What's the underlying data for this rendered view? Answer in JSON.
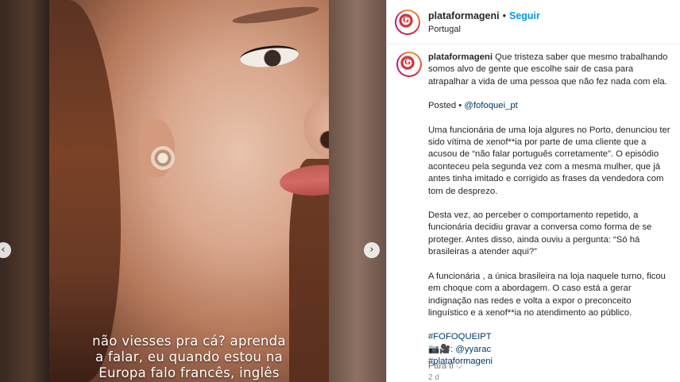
{
  "post": {
    "author": "plataformageni",
    "follow_label": "Seguir",
    "location": "Portugal",
    "avatar_letter": "G"
  },
  "media": {
    "caption_lines": [
      "não viesses pra cá? aprenda",
      "a falar, eu quando estou na",
      "Europa falo francês, inglês"
    ],
    "prev_icon": "chevron-left-icon",
    "next_icon": "chevron-right-icon"
  },
  "caption": {
    "intro": "Que tristeza saber que mesmo trabalhando somos alvo de gente que escolhe sair de casa para atrapalhar a vida de uma pessoa que não fez nada com ela.",
    "posted_label": "Posted •",
    "posted_handle": "@fofoquei_pt",
    "paragraph1": "Uma funcionária de uma loja algures no Porto, denunciou ter sido vítima de xenof**ia por parte de uma cliente que a acusou de “não falar português corretamente”. O episódio aconteceu pela segunda vez com a mesma mulher, que já antes tinha imitado e corrigido as frases da vendedora com tom de desprezo.",
    "paragraph2": "Desta vez, ao perceber o comportamento repetido, a funcionária decidiu gravar a conversa como forma de se proteger. Antes disso, ainda ouviu a pergunta: “Só há brasileiras a atender aqui?”",
    "paragraph3": "A funcionária , a única brasileira na loja naquele turno, ficou em choque com a abordagem. O caso está a gerar indignação nas redes e volta a expor o preconceito linguístico e a xenof**ia no atendimento ao público.",
    "hashtag1": "#FOFOQUEIPT",
    "credit_prefix": "📷🎥:",
    "credit_handle": "@yyarac",
    "hashtag2": "#plataformageni",
    "time_ago": "2 d",
    "translate_label": "Para ti ⌵"
  },
  "colors": {
    "accent": "#0095f6",
    "link": "#00376b"
  }
}
